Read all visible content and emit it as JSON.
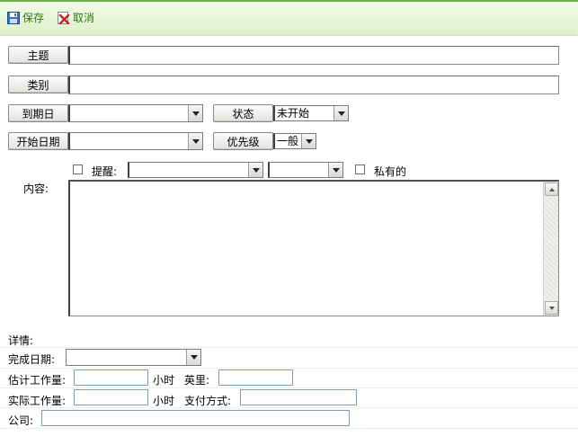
{
  "toolbar": {
    "save_label": "保存",
    "cancel_label": "取消"
  },
  "fields": {
    "subject_label": "主题",
    "subject_value": "",
    "category_label": "类别",
    "category_value": "",
    "due_date_label": "到期日",
    "due_date_value": "",
    "status_label": "状态",
    "status_value": "未开始",
    "start_date_label": "开始日期",
    "start_date_value": "",
    "priority_label": "优先级",
    "priority_value": "一般",
    "reminder_label": "提醒:",
    "reminder_date_value": "",
    "reminder_time_value": "",
    "private_label": "私有的",
    "content_label": "内容:",
    "content_value": ""
  },
  "details": {
    "heading": "详情:",
    "completed_date_label": "完成日期:",
    "completed_date_value": "",
    "estimated_work_label": "估计工作量:",
    "estimated_work_value": "",
    "hours_label_1": "小时",
    "mileage_label": "英里:",
    "mileage_value": "",
    "actual_work_label": "实际工作量:",
    "actual_work_value": "",
    "hours_label_2": "小时",
    "billing_label": "支付方式:",
    "billing_value": "",
    "company_label": "公司:",
    "company_value": ""
  },
  "colors": {
    "toolbar_text": "#2b7a0b",
    "toolbar_border": "#6fb43e"
  }
}
